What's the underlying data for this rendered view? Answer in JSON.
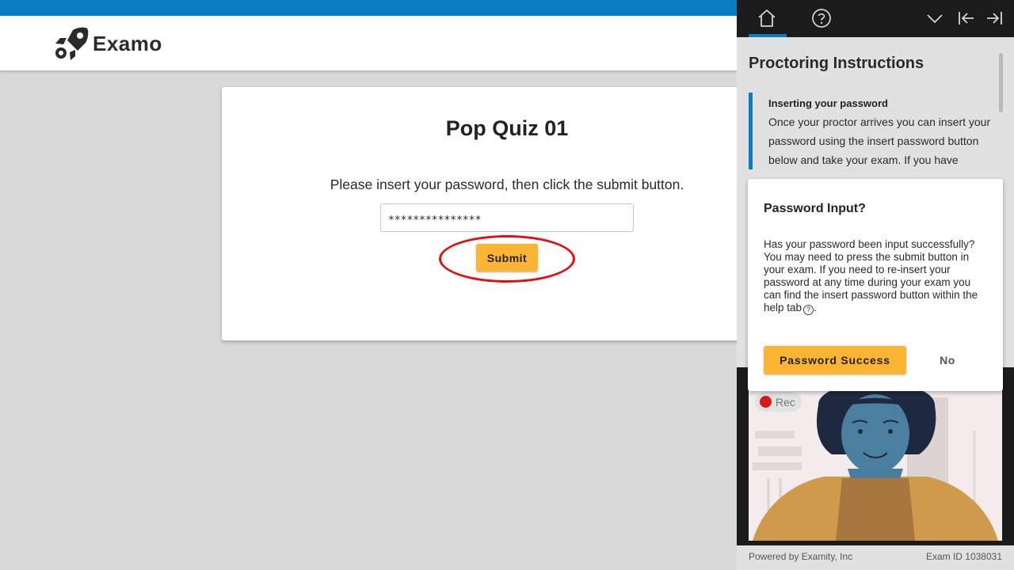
{
  "app": {
    "brand": "Examo",
    "accent": "#0a7cc1",
    "button_color": "#fbb532",
    "highlight_color": "#e50d12"
  },
  "quiz": {
    "title": "Pop Quiz 01",
    "instruction": "Please insert your password, then click the submit button.",
    "password_value": "***************",
    "submit_label": "Submit"
  },
  "panel": {
    "nav": {
      "home_icon": "home-icon",
      "help_icon": "help-icon",
      "collapse_icon": "chevron-down-icon",
      "dock_left_icon": "dock-left-icon",
      "dock_right_icon": "dock-right-icon"
    },
    "title": "Proctoring Instructions",
    "instruction_heading": "Inserting your password",
    "instruction_body": "Once your proctor arrives you can insert your password using the insert password button below and take your exam. If you have",
    "rec_label": "Rec",
    "footer_left": "Powered by Examity, Inc",
    "footer_right": "Exam ID 1038031"
  },
  "modal": {
    "title": "Password Input?",
    "body": "Has your password been input successfully? You may need to press the submit button in your exam. If you need to re-insert your password at any time during your exam you can find the insert password button within the help tab",
    "body_end": ".",
    "help_glyph": "?",
    "success_label": "Password Success",
    "no_label": "No"
  }
}
